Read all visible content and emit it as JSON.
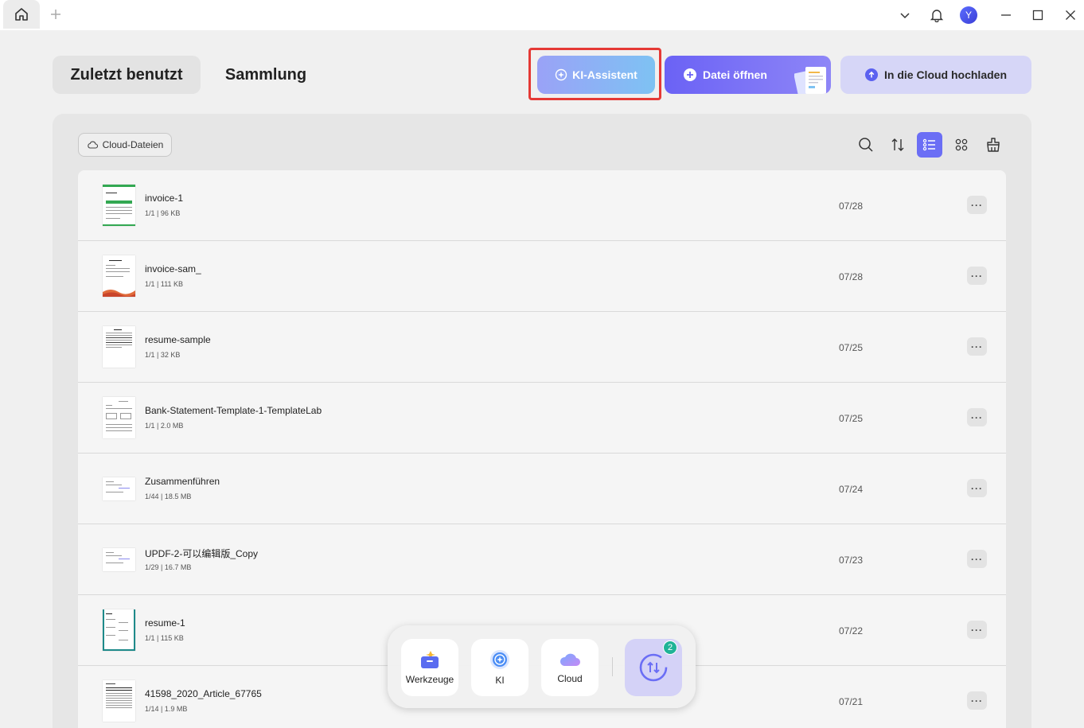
{
  "titlebar": {
    "avatar_letter": "Y"
  },
  "tabs": [
    {
      "label": "Zuletzt benutzt",
      "active": true
    },
    {
      "label": "Sammlung",
      "active": false
    }
  ],
  "actions": {
    "ki_label": "KI-Assistent",
    "open_label": "Datei öffnen",
    "cloud_label": "In die Cloud hochladen"
  },
  "toolbar": {
    "cloud_chip": "Cloud-Dateien"
  },
  "files": [
    {
      "name": "invoice-1",
      "meta": "1/1 | 96 KB",
      "date": "07/28"
    },
    {
      "name": "invoice-sam_",
      "meta": "1/1 | 111 KB",
      "date": "07/28"
    },
    {
      "name": "resume-sample",
      "meta": "1/1 | 32 KB",
      "date": "07/25"
    },
    {
      "name": "Bank-Statement-Template-1-TemplateLab",
      "meta": "1/1 | 2.0 MB",
      "date": "07/25"
    },
    {
      "name": "Zusammenführen",
      "meta": "1/44 | 18.5 MB",
      "date": "07/24"
    },
    {
      "name": "UPDF-2-可以编辑版_Copy",
      "meta": "1/29 | 16.7 MB",
      "date": "07/23"
    },
    {
      "name": "resume-1",
      "meta": "1/1 | 115 KB",
      "date": "07/22"
    },
    {
      "name": "41598_2020_Article_67765",
      "meta": "1/14 | 1.9 MB",
      "date": "07/21"
    }
  ],
  "dock": {
    "tools_label": "Werkzeuge",
    "ki_label": "KI",
    "cloud_label": "Cloud",
    "sync_badge": "2"
  },
  "colors": {
    "accent": "#6b6ef5",
    "highlight": "#e53935",
    "badge": "#1fb397"
  }
}
